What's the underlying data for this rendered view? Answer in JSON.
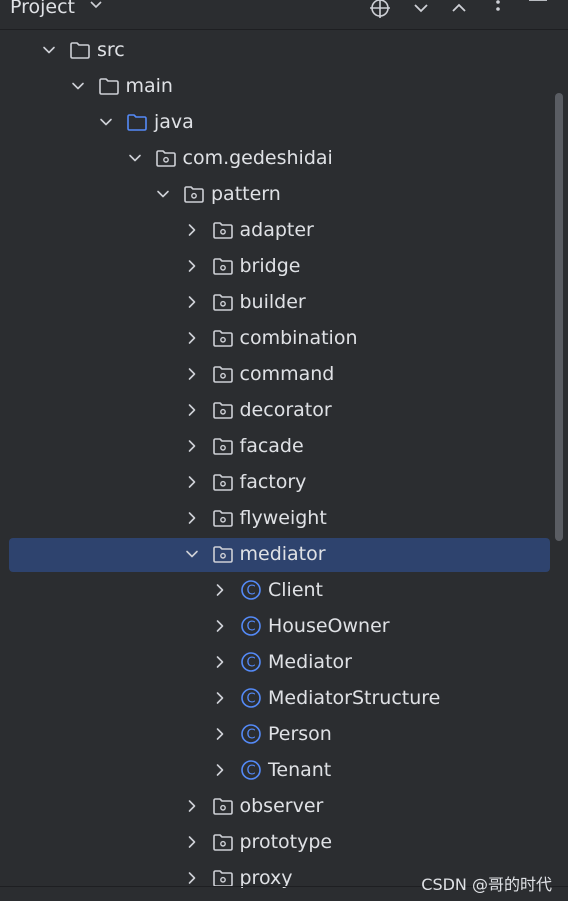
{
  "header": {
    "title": "Project",
    "icons": [
      "chevron-down-icon",
      "locate-icon",
      "expand-all-icon",
      "collapse-all-icon",
      "more-icon"
    ]
  },
  "tree": [
    {
      "label": "src",
      "depth": 0,
      "kind": "folder",
      "expanded": true
    },
    {
      "label": "main",
      "depth": 1,
      "kind": "folder",
      "expanded": true
    },
    {
      "label": "java",
      "depth": 2,
      "kind": "source-folder",
      "expanded": true
    },
    {
      "label": "com.gedeshidai",
      "depth": 3,
      "kind": "package",
      "expanded": true
    },
    {
      "label": "pattern",
      "depth": 4,
      "kind": "package",
      "expanded": true
    },
    {
      "label": "adapter",
      "depth": 5,
      "kind": "package",
      "expanded": false
    },
    {
      "label": "bridge",
      "depth": 5,
      "kind": "package",
      "expanded": false
    },
    {
      "label": "builder",
      "depth": 5,
      "kind": "package",
      "expanded": false
    },
    {
      "label": "combination",
      "depth": 5,
      "kind": "package",
      "expanded": false
    },
    {
      "label": "command",
      "depth": 5,
      "kind": "package",
      "expanded": false
    },
    {
      "label": "decorator",
      "depth": 5,
      "kind": "package",
      "expanded": false
    },
    {
      "label": "facade",
      "depth": 5,
      "kind": "package",
      "expanded": false
    },
    {
      "label": "factory",
      "depth": 5,
      "kind": "package",
      "expanded": false
    },
    {
      "label": "flyweight",
      "depth": 5,
      "kind": "package",
      "expanded": false
    },
    {
      "label": "mediator",
      "depth": 5,
      "kind": "package",
      "expanded": true,
      "selected": true
    },
    {
      "label": "Client",
      "depth": 6,
      "kind": "class",
      "expanded": false
    },
    {
      "label": "HouseOwner",
      "depth": 6,
      "kind": "class",
      "expanded": false
    },
    {
      "label": "Mediator",
      "depth": 6,
      "kind": "class",
      "expanded": false
    },
    {
      "label": "MediatorStructure",
      "depth": 6,
      "kind": "class",
      "expanded": false
    },
    {
      "label": "Person",
      "depth": 6,
      "kind": "class",
      "expanded": false
    },
    {
      "label": "Tenant",
      "depth": 6,
      "kind": "class",
      "expanded": false
    },
    {
      "label": "observer",
      "depth": 5,
      "kind": "package",
      "expanded": false
    },
    {
      "label": "prototype",
      "depth": 5,
      "kind": "package",
      "expanded": false
    },
    {
      "label": "proxy",
      "depth": 5,
      "kind": "package",
      "expanded": false
    }
  ],
  "watermark": "CSDN @哥的时代",
  "colors": {
    "background": "#2b2d30",
    "selection": "#2e436e",
    "text": "#dfe1e5",
    "folder_stroke": "#ced0d6",
    "source_folder_stroke": "#548af7",
    "class_icon": "#548af7"
  }
}
